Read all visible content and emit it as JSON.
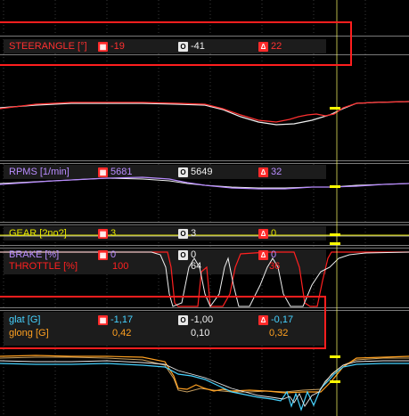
{
  "colors": {
    "reference": "#ff2020",
    "compare": "#f0f0f0",
    "steer": "#ff3030",
    "rpm": "#b98cff",
    "gear": "#e6e600",
    "brake": "#b98cff",
    "throttle": "#ff2020",
    "glat": "#46d2ff",
    "glong": "#ffa020",
    "cursor": "#ffff00",
    "highlight_box": "#ff1e1e"
  },
  "icons": {
    "reference": "reference-lap-icon",
    "compare": "compare-lap-icon",
    "delta": "delta-icon"
  },
  "channels": [
    {
      "id": "steer",
      "label": "STEERANGLE [°]",
      "ref": "-19",
      "cmp": "-41",
      "delta": "22"
    },
    {
      "id": "rpm",
      "label": "RPMS [1/min]",
      "ref": "5681",
      "cmp": "5649",
      "delta": "32"
    },
    {
      "id": "gear",
      "label": "GEAR [?no?]",
      "ref": "3",
      "cmp": "3",
      "delta": "0"
    },
    {
      "id": "brake",
      "label": "BRAKE [%]",
      "ref": "0",
      "cmp": "0",
      "delta": "0"
    },
    {
      "id": "throttle",
      "label": "THROTTLE [%]",
      "ref": "100",
      "cmp": "64",
      "delta": "36"
    },
    {
      "id": "glat",
      "label": "glat [G]",
      "ref": "-1,17",
      "cmp": "-1,00",
      "delta": "-0,17"
    },
    {
      "id": "glong",
      "label": "glong [G]",
      "ref": "0,42",
      "cmp": "0,10",
      "delta": "0,32"
    }
  ]
}
